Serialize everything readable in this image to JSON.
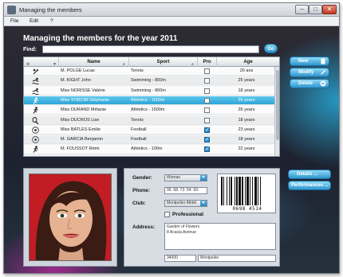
{
  "window": {
    "title": "Managing the members"
  },
  "menu": {
    "items": [
      "File",
      "Edit",
      "?"
    ]
  },
  "page": {
    "heading": "Managing the members for the year 2011"
  },
  "search": {
    "label": "Find:",
    "value": "",
    "go_label": "Go"
  },
  "table": {
    "columns": [
      "Name",
      "Sport",
      "Pro",
      "Age"
    ],
    "rows": [
      {
        "icon": "golf-icon",
        "name": "M. POLGE Lucas",
        "sport": "Tennis",
        "pro": false,
        "age": "20 ans"
      },
      {
        "icon": "swimmer-icon",
        "name": "M. KIGHT John",
        "sport": "Swimming - 800m",
        "pro": false,
        "age": "25 years"
      },
      {
        "icon": "swimmer-icon",
        "name": "Miss NORISSE Valérie",
        "sport": "Swimming - 800m",
        "pro": false,
        "age": "18 years"
      },
      {
        "icon": "runner-icon",
        "name": "Miss YORCIM Stéphanie",
        "sport": "Athletics - 1500m",
        "pro": false,
        "age": "25 years",
        "selected": true
      },
      {
        "icon": "runner-icon",
        "name": "Miss DURAND Mélanie",
        "sport": "Athletics - 1500m",
        "pro": false,
        "age": "26 years"
      },
      {
        "icon": "tennis-icon",
        "name": "Miss DUCROS Lise",
        "sport": "Tennis",
        "pro": false,
        "age": "18 years"
      },
      {
        "icon": "football-icon",
        "name": "Miss BATLES Emilie",
        "sport": "Football",
        "pro": true,
        "age": "23 years"
      },
      {
        "icon": "football-icon",
        "name": "M. GARCIA Benjamin",
        "sport": "Football",
        "pro": true,
        "age": "18 years"
      },
      {
        "icon": "runner-icon",
        "name": "M. FOUSSOT Rémi",
        "sport": "Athletics - 100m",
        "pro": true,
        "age": "22 years"
      }
    ]
  },
  "buttons": {
    "new": "New",
    "modify": "Modify",
    "delete": "Delete",
    "details": "Details ...",
    "performances": "Performances ..."
  },
  "form": {
    "gender_label": "Gender:",
    "gender_value": "Woman",
    "phone_label": "Phone:",
    "phone_value": "06. 68. 72. 54. 93.",
    "club_label": "Club:",
    "club_value": "Montpelier Athlét",
    "professional_label": "Professional",
    "professional_checked": false,
    "address_label": "Address:",
    "address_line1": "Garden of Flowers",
    "address_line2": "8 Acacia Avenue",
    "postcode": "34000",
    "city": "Montpelier",
    "barcode_number": "0698 4514"
  }
}
